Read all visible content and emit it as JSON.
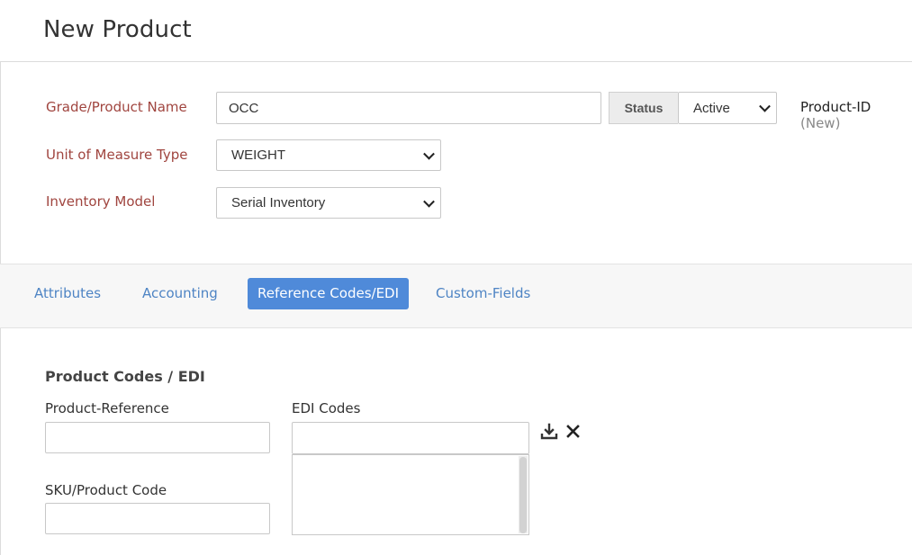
{
  "page": {
    "title": "New Product"
  },
  "form": {
    "grade_label": "Grade/Product Name",
    "grade_value": "OCC",
    "status_label": "Status",
    "status_value": "Active",
    "product_id_label": "Product-ID",
    "product_id_value": "(New)",
    "uom_label": "Unit of Measure Type",
    "uom_value": "WEIGHT",
    "inventory_label": "Inventory Model",
    "inventory_value": "Serial Inventory"
  },
  "tabs": [
    {
      "label": "Attributes",
      "active": false
    },
    {
      "label": "Accounting",
      "active": false
    },
    {
      "label": "Reference Codes/EDI",
      "active": true
    },
    {
      "label": "Custom-Fields",
      "active": false
    }
  ],
  "codes": {
    "section_title": "Product Codes / EDI",
    "product_reference_label": "Product-Reference",
    "product_reference_value": "",
    "sku_label": "SKU/Product Code",
    "sku_value": "",
    "edi_label": "EDI Codes",
    "edi_input_value": "",
    "edi_list": ""
  },
  "icons": {
    "download": "download-icon",
    "remove": "close-icon"
  },
  "colors": {
    "label_red": "#a0453f",
    "tab_link": "#4e84c4",
    "tab_active": "#4f8ad9"
  }
}
